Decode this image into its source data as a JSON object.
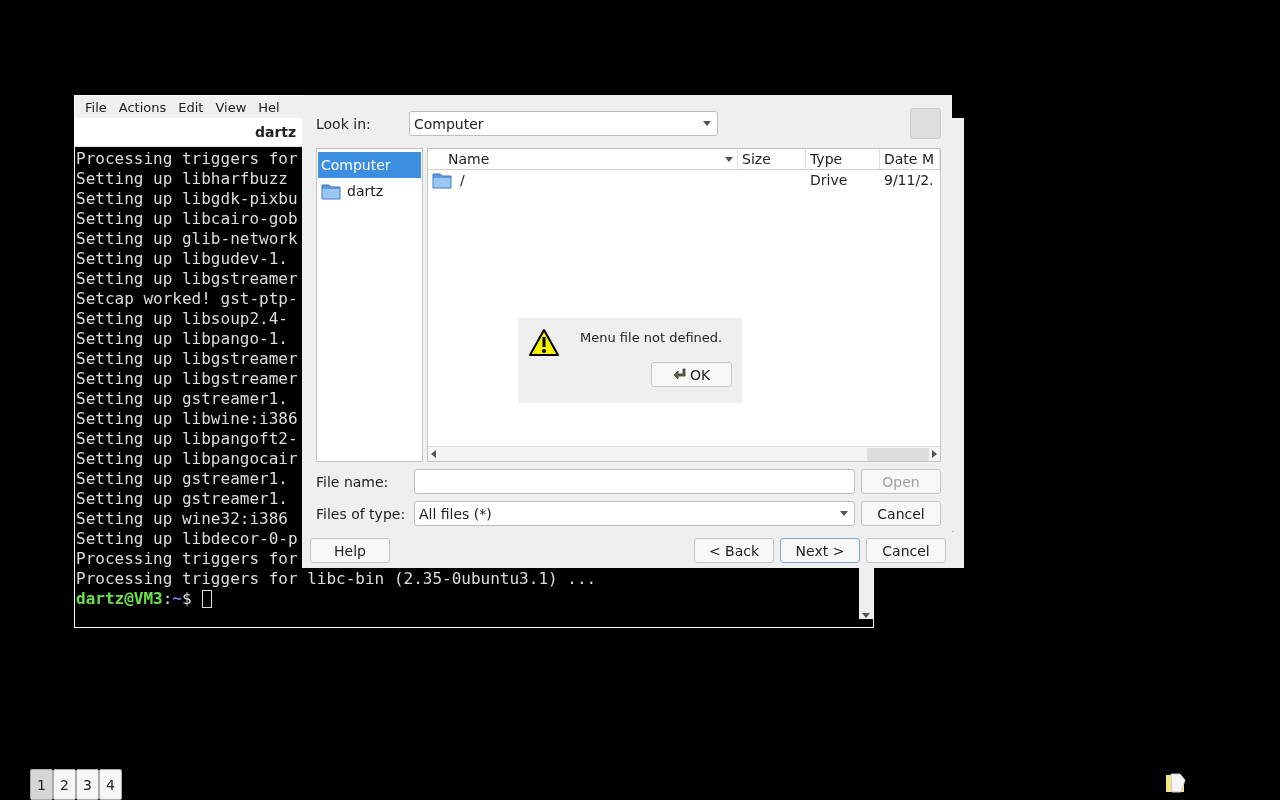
{
  "terminal": {
    "menu": [
      "File",
      "Actions",
      "Edit",
      "View",
      "Hel"
    ],
    "title": "dartz",
    "lines": [
      "Processing triggers for",
      "Setting up libharfbuzz",
      "Setting up libgdk-pixbu",
      "Setting up libcairo-gob",
      "Setting up glib-network",
      "Setting up libgudev-1.",
      "Setting up libgstreamer",
      "Setcap worked! gst-ptp-",
      "Setting up libsoup2.4-",
      "Setting up libpango-1.",
      "Setting up libgstreamer",
      "Setting up libgstreamer",
      "Setting up gstreamer1.",
      "Setting up libwine:i386",
      "Setting up libpangoft2-",
      "Setting up libpangocair",
      "Setting up gstreamer1.",
      "Setting up gstreamer1.",
      "Setting up wine32:i386",
      "Setting up libdecor-0-p",
      "Processing triggers for",
      "Processing triggers for libc-bin (2.35-0ubuntu3.1) ..."
    ],
    "prompt": {
      "user": "dartz@VM3",
      "sep": ":",
      "path": "~",
      "symbol": "$"
    }
  },
  "file_dialog": {
    "look_in": {
      "label": "Look in:",
      "value": "Computer"
    },
    "places": [
      {
        "label": "Computer",
        "kind": "computer",
        "selected": true
      },
      {
        "label": "dartz",
        "kind": "folder",
        "selected": false
      }
    ],
    "columns": [
      "Name",
      "Size",
      "Type",
      "Date M"
    ],
    "rows": [
      {
        "name": "/",
        "type": "Drive",
        "date": "9/11/2."
      }
    ],
    "file_name": {
      "label": "File name:"
    },
    "open_button": {
      "label": "Open",
      "disabled": true
    },
    "file_type": {
      "label": "Files of type:",
      "value": "All files (*)"
    },
    "cancel_button": {
      "label": "Cancel"
    }
  },
  "message_box": {
    "text": "Menu file not defined.",
    "button": "OK"
  },
  "wizard": {
    "buttons": [
      {
        "label": "Help",
        "default": false
      },
      {
        "label": "< Back",
        "default": false
      },
      {
        "label": "Next >",
        "default": true
      },
      {
        "label": "Cancel",
        "default": false
      }
    ]
  },
  "workspaces": [
    {
      "label": "1",
      "selected": true
    },
    {
      "label": "2",
      "selected": false
    },
    {
      "label": "3",
      "selected": false
    },
    {
      "label": "4",
      "selected": false
    }
  ]
}
